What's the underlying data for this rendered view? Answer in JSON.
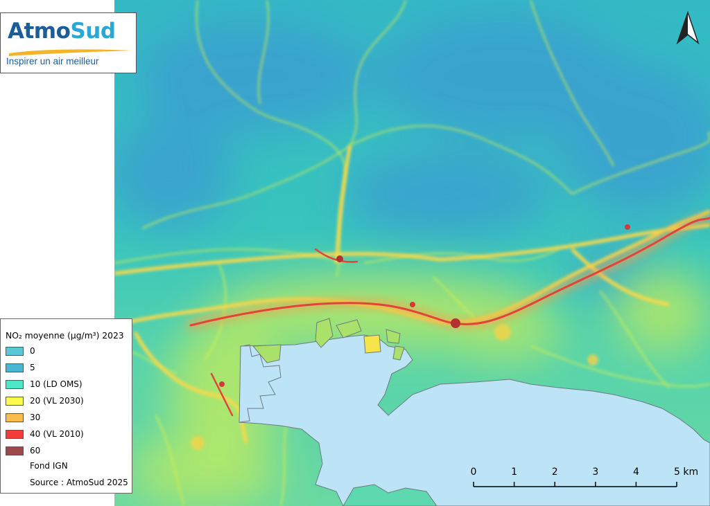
{
  "logo": {
    "brand_part1": "Atmo",
    "brand_part2": "Sud",
    "tagline": "Inspirer un air meilleur",
    "colors": {
      "atmo": "#1c5d99",
      "sud": "#2aa7d6",
      "swoosh": "#f3b428"
    }
  },
  "legend": {
    "title": "NO₂ moyenne (µg/m³) 2023",
    "classes": [
      {
        "label": "0",
        "color": "#5ac6d8"
      },
      {
        "label": "5",
        "color": "#49b7d4"
      },
      {
        "label": "10 (LD OMS)",
        "color": "#4ee6c9"
      },
      {
        "label": "20 (VL 2030)",
        "color": "#fcfb4b"
      },
      {
        "label": "30",
        "color": "#f9bd4f"
      },
      {
        "label": "40 (VL 2010)",
        "color": "#f53a3a"
      },
      {
        "label": "60",
        "color": "#9b4a4a"
      }
    ],
    "basemap": "Fond IGN",
    "source": "Source : AtmoSud 2025"
  },
  "scale": {
    "labels": [
      "0",
      "1",
      "2",
      "3",
      "4",
      "5 km"
    ]
  },
  "map_colors": {
    "sea": "#bde3f7",
    "coast": "#6b7a7f",
    "background": "#35c1bf",
    "hills": "#3aa6cd",
    "roads_low": "#d9f04a",
    "roads_mid": "#f5c54a",
    "roads_high": "#e03a3a"
  },
  "icons": {
    "north": "north-arrow-icon"
  }
}
